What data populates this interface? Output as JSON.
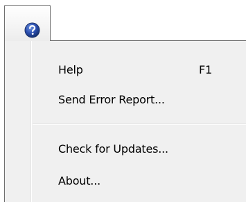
{
  "toolbar": {
    "help_icon": "question-mark-icon",
    "accent": "#1f3f8f"
  },
  "menu": {
    "items": [
      {
        "label": "Help",
        "shortcut": "F1"
      },
      {
        "label": "Send Error Report...",
        "shortcut": ""
      },
      {
        "label": "Check for Updates...",
        "shortcut": ""
      },
      {
        "label": "About...",
        "shortcut": ""
      }
    ]
  }
}
